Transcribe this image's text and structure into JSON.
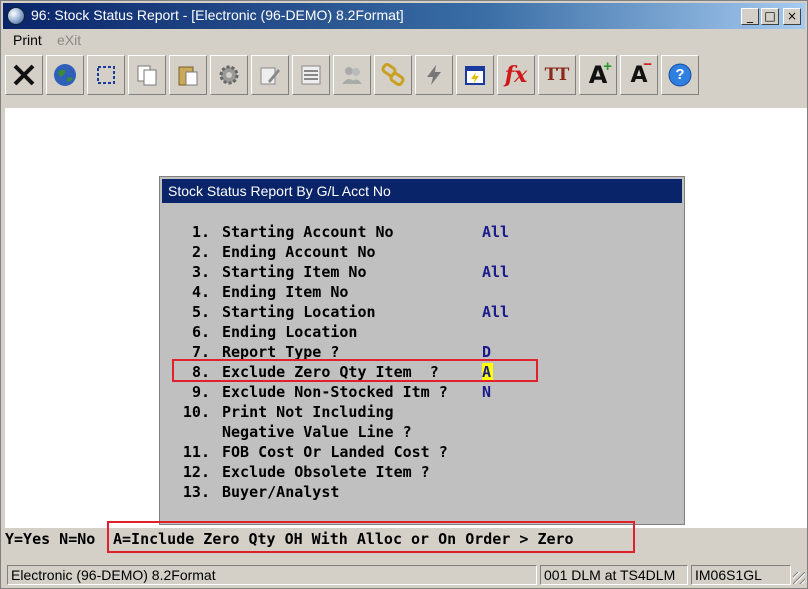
{
  "window": {
    "title": "96: Stock Status Report - [Electronic (96-DEMO) 8.2Format]",
    "controls": {
      "minimize": "_",
      "maximize": "□",
      "close": "×"
    }
  },
  "menu": {
    "print": "Print",
    "exit": "eXit"
  },
  "toolbar": {
    "tools": [
      "close-icon",
      "globe-icon",
      "select-icon",
      "copy-icon",
      "paste-icon",
      "settings-icon",
      "edit-icon",
      "list-icon",
      "users-icon",
      "link-icon",
      "lightning-icon",
      "calendar-icon",
      "function-icon",
      "font-icon",
      "increase-font-icon",
      "decrease-font-icon",
      "help-icon"
    ],
    "fx": "fx",
    "tt": "TT",
    "a_plus": "A",
    "a_minus": "A",
    "help": "?"
  },
  "dialog": {
    "title": "Stock Status Report By G/L Acct No",
    "options": [
      {
        "num": "1.",
        "label": "Starting Account No",
        "value": "All"
      },
      {
        "num": "2.",
        "label": "Ending Account No",
        "value": ""
      },
      {
        "num": "3.",
        "label": "Starting Item No",
        "value": "All"
      },
      {
        "num": "4.",
        "label": "Ending Item No",
        "value": ""
      },
      {
        "num": "5.",
        "label": "Starting Location",
        "value": "All"
      },
      {
        "num": "6.",
        "label": "Ending Location",
        "value": ""
      },
      {
        "num": "7.",
        "label": "Report Type ?",
        "value": "D"
      },
      {
        "num": "8.",
        "label": "Exclude Zero Qty Item  ?",
        "value": "A"
      },
      {
        "num": "9.",
        "label": "Exclude Non-Stocked Itm ?",
        "value": "N"
      },
      {
        "num": "10.",
        "label": "Print Not Including",
        "value": ""
      },
      {
        "num": "",
        "label": "Negative Value Line ?",
        "value": ""
      },
      {
        "num": "11.",
        "label": "FOB Cost Or Landed Cost ?",
        "value": ""
      },
      {
        "num": "12.",
        "label": "Exclude Obsolete Item ?",
        "value": ""
      },
      {
        "num": "13.",
        "label": "Buyer/Analyst",
        "value": ""
      }
    ]
  },
  "help": {
    "left": "Y=Yes N=No",
    "right": "A=Include Zero Qty OH With Alloc or On Order > Zero"
  },
  "status": {
    "company": "Electronic (96-DEMO) 8.2Format",
    "user": "001 DLM at TS4DLM",
    "program": "IM06S1GL"
  },
  "colors": {
    "highlight": "#e0202a",
    "value_text": "#1a1a8c",
    "cursor": "#ffff00",
    "title_bar": "#0a246a"
  }
}
